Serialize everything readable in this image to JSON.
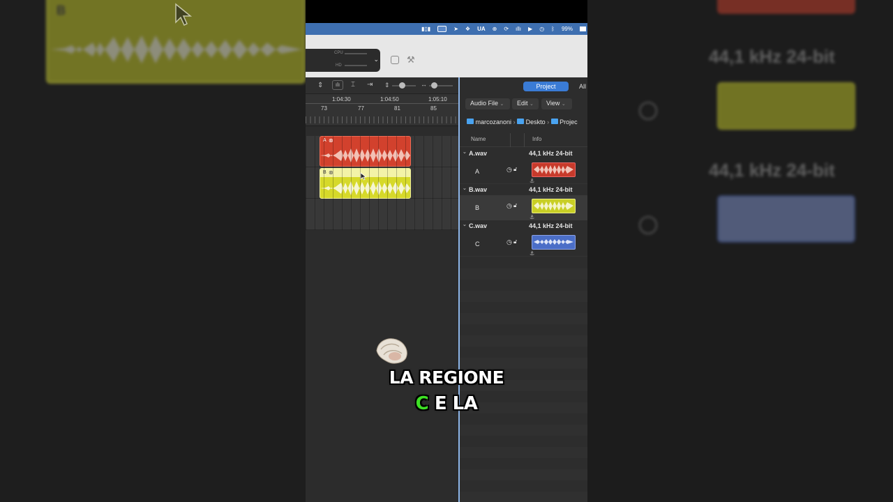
{
  "menubar": {
    "items": [
      "waveform-icon",
      "screen-icon",
      "location-icon",
      "dropbox-icon",
      "UA",
      "globe-icon",
      "sync-icon",
      "wave-icon",
      "play-icon",
      "timemachine-icon",
      "bluetooth-icon"
    ],
    "ua_label": "UA",
    "battery": "99%"
  },
  "lcd": {
    "cpu_label": "CPU",
    "hd_label": "HD"
  },
  "ruler": {
    "times": [
      "1:04:30",
      "1:04:50",
      "1:05:10"
    ],
    "bars": [
      "73",
      "77",
      "81",
      "85"
    ]
  },
  "regions": [
    {
      "label": "A",
      "color": "#d2412d"
    },
    {
      "label": "B",
      "color": "#d6d92a"
    }
  ],
  "browser": {
    "tabs": {
      "project": "Project",
      "all": "All"
    },
    "menus": {
      "audio_file": "Audio File",
      "edit": "Edit",
      "view": "View"
    },
    "path": [
      "marcozanoni",
      "Deskto",
      "Projec"
    ],
    "columns": {
      "name": "Name",
      "info": "Info"
    },
    "files": [
      {
        "file": "A.wav",
        "info": "44,1 kHz  24-bit",
        "clip": "A",
        "color": "#c73a2b"
      },
      {
        "file": "B.wav",
        "info": "44,1 kHz  24-bit",
        "clip": "B",
        "color": "#c9cf25"
      },
      {
        "file": "C.wav",
        "info": "44,1 kHz  24-bit",
        "clip": "C",
        "color": "#4b6ec7"
      }
    ]
  },
  "side_right": {
    "info1": "44,1 kHz  24-bit",
    "info2": "44,1 kHz  24-bit"
  },
  "side_left": {
    "region_label": "B"
  },
  "subtitle": {
    "line1": "LA REGIONE",
    "line2_accent": "C",
    "line2_rest": " E LA"
  },
  "colors": {
    "accent": "#3de024",
    "menubar": "#3e6fb0",
    "selected_tab": "#3a7bd5"
  }
}
